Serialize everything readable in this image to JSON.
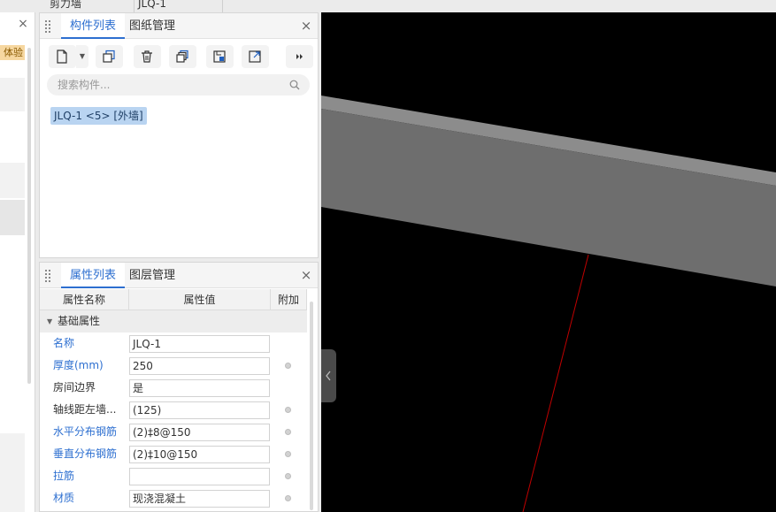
{
  "top_strip": {
    "left_cell": "剪力墙",
    "right_cell": "JLQ-1"
  },
  "left_panel": {
    "badge": "体验"
  },
  "component_panel": {
    "tabs": [
      {
        "label": "构件列表",
        "active": true
      },
      {
        "label": "图纸管理",
        "active": false
      }
    ],
    "toolbar": [
      "new-component-icon",
      "copy-icon",
      "delete-icon",
      "layer-copy-icon",
      "floor-copy-icon",
      "export-icon",
      "more-icon"
    ],
    "search": {
      "placeholder": "搜索构件..."
    },
    "items": [
      {
        "label": "JLQ-1 <5> [外墙]",
        "selected": true
      }
    ]
  },
  "property_panel": {
    "tabs": [
      {
        "label": "属性列表",
        "active": true
      },
      {
        "label": "图层管理",
        "active": false
      }
    ],
    "columns": [
      "属性名称",
      "属性值",
      "附加"
    ],
    "group": "基础属性",
    "rows": [
      {
        "name": "名称",
        "value": "JLQ-1",
        "blue": true,
        "has_dot": false
      },
      {
        "name": "厚度(mm)",
        "value": "250",
        "blue": true,
        "has_dot": true
      },
      {
        "name": "房间边界",
        "value": "是",
        "blue": false,
        "has_dot": false
      },
      {
        "name": "轴线距左墙...",
        "value": "(125)",
        "blue": false,
        "has_dot": true
      },
      {
        "name": "水平分布钢筋",
        "value": "(2)‡8@150",
        "blue": true,
        "has_dot": true
      },
      {
        "name": "垂直分布钢筋",
        "value": "(2)‡10@150",
        "blue": true,
        "has_dot": true
      },
      {
        "name": "拉筋",
        "value": "",
        "blue": true,
        "has_dot": true
      },
      {
        "name": "材质",
        "value": "现浇混凝土",
        "blue": true,
        "has_dot": true
      }
    ]
  },
  "colors": {
    "accent": "#2d6fd0",
    "selected_bg": "#b9d4f1",
    "viewport_bg": "#000000",
    "axis_line": "#c00000"
  }
}
